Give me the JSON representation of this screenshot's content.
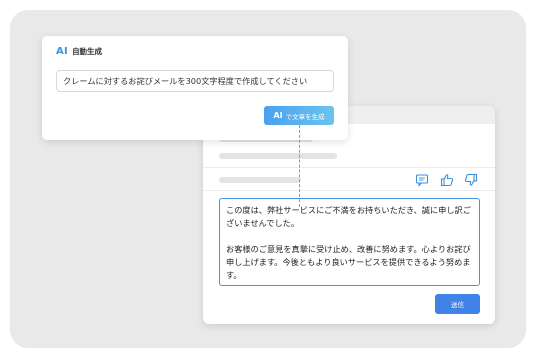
{
  "ai_panel": {
    "badge": "AI",
    "title": "自動生成",
    "prompt_value": "クレームに対するお詫びメールを300文字程度で作成してください",
    "generate_button": {
      "badge": "AI",
      "label": "で文章を生成"
    }
  },
  "message_panel": {
    "action_icons": [
      "comment-icon",
      "thumbs-up-icon",
      "thumbs-down-icon"
    ],
    "reply_paragraph_1": "この度は、弊社サービスにご不満をお持ちいただき、誠に申し訳ございませんでした。",
    "reply_paragraph_2": "お客様のご意見を真摯に受け止め、改善に努めます。心よりお詫び申し上げます。今後ともより良いサービスを提供できるよう努めます。",
    "send_button": "送信"
  },
  "colors": {
    "accent": "#3b92e4",
    "send": "#3f83e6",
    "background": "#e9e9ea"
  }
}
